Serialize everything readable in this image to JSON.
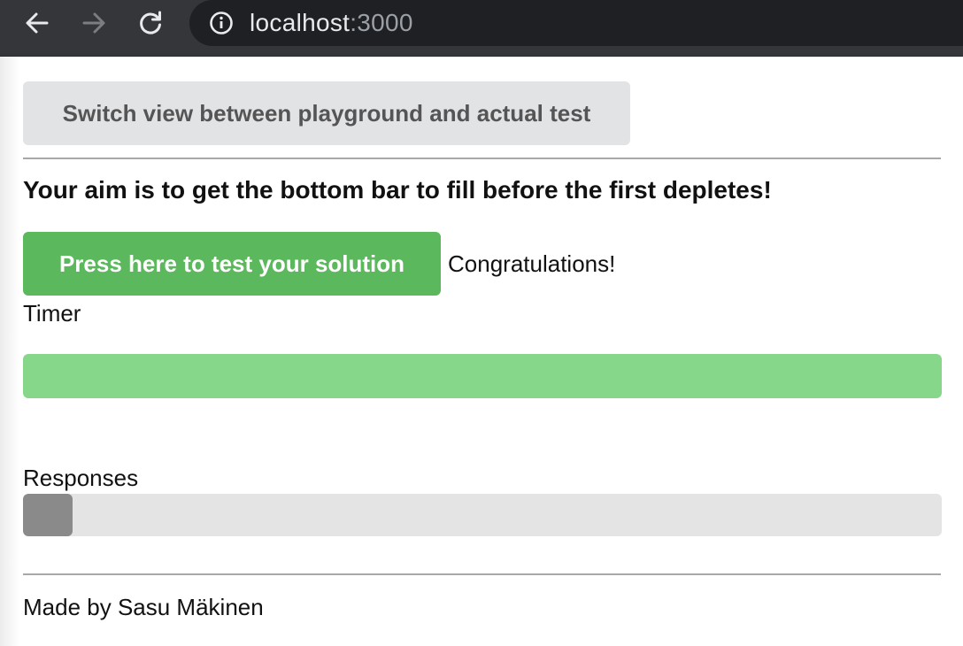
{
  "browser": {
    "url_host": "localhost",
    "url_port": ":3000",
    "icons": [
      "back-arrow-icon",
      "forward-arrow-icon",
      "reload-icon",
      "info-icon"
    ]
  },
  "page": {
    "switch_button_label": "Switch view between playground and actual test",
    "aim_text": "Your aim is to get the bottom bar to fill before the first depletes!",
    "test_button_label": "Press here to test your solution",
    "status_text": "Congratulations!",
    "timer_label": "Timer",
    "timer_progress": 1.0,
    "responses_label": "Responses",
    "responses_progress": 0.054,
    "footer_text": "Made by Sasu Mäkinen"
  },
  "colors": {
    "test_button": "#5cb85c",
    "switch_button": "#e2e3e5",
    "timer_fill": "#86d78a",
    "responses_fill": "#8a8a8a",
    "track": "#e4e4e4"
  }
}
